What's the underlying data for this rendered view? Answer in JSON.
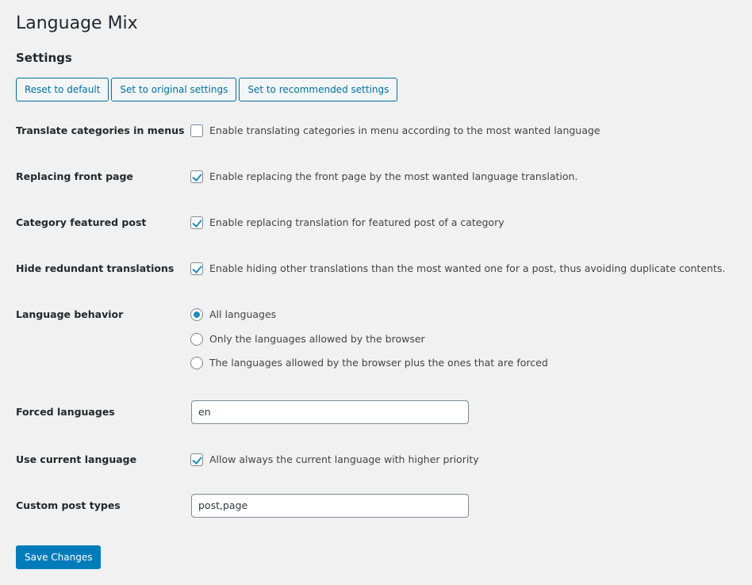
{
  "page": {
    "title": "Language Mix",
    "section_title": "Settings"
  },
  "toolbar": {
    "reset_label": "Reset to default",
    "original_label": "Set to original settings",
    "recommended_label": "Set to recommended settings"
  },
  "settings": {
    "translate_categories": {
      "label": "Translate categories in menus",
      "option": "Enable translating categories in menu according to the most wanted language",
      "checked": false
    },
    "replacing_front_page": {
      "label": "Replacing front page",
      "option": "Enable replacing the front page by the most wanted language translation.",
      "checked": true
    },
    "category_featured_post": {
      "label": "Category featured post",
      "option": "Enable replacing translation for featured post of a category",
      "checked": true
    },
    "hide_redundant": {
      "label": "Hide redundant translations",
      "option": "Enable hiding other translations than the most wanted one for a post, thus avoiding duplicate contents.",
      "checked": true
    },
    "language_behavior": {
      "label": "Language behavior",
      "options": [
        "All languages",
        "Only the languages allowed by the browser",
        "The languages allowed by the browser plus the ones that are forced"
      ],
      "selected": "All languages"
    },
    "forced_languages": {
      "label": "Forced languages",
      "value": "en"
    },
    "use_current_language": {
      "label": "Use current language",
      "option": "Allow always the current language with higher priority",
      "checked": true
    },
    "custom_post_types": {
      "label": "Custom post types",
      "value": "post,page"
    }
  },
  "footer": {
    "save_label": "Save Changes"
  },
  "colors": {
    "accent": "#007cba",
    "secondary_border": "#0071a1",
    "background": "#f1f1f1"
  }
}
